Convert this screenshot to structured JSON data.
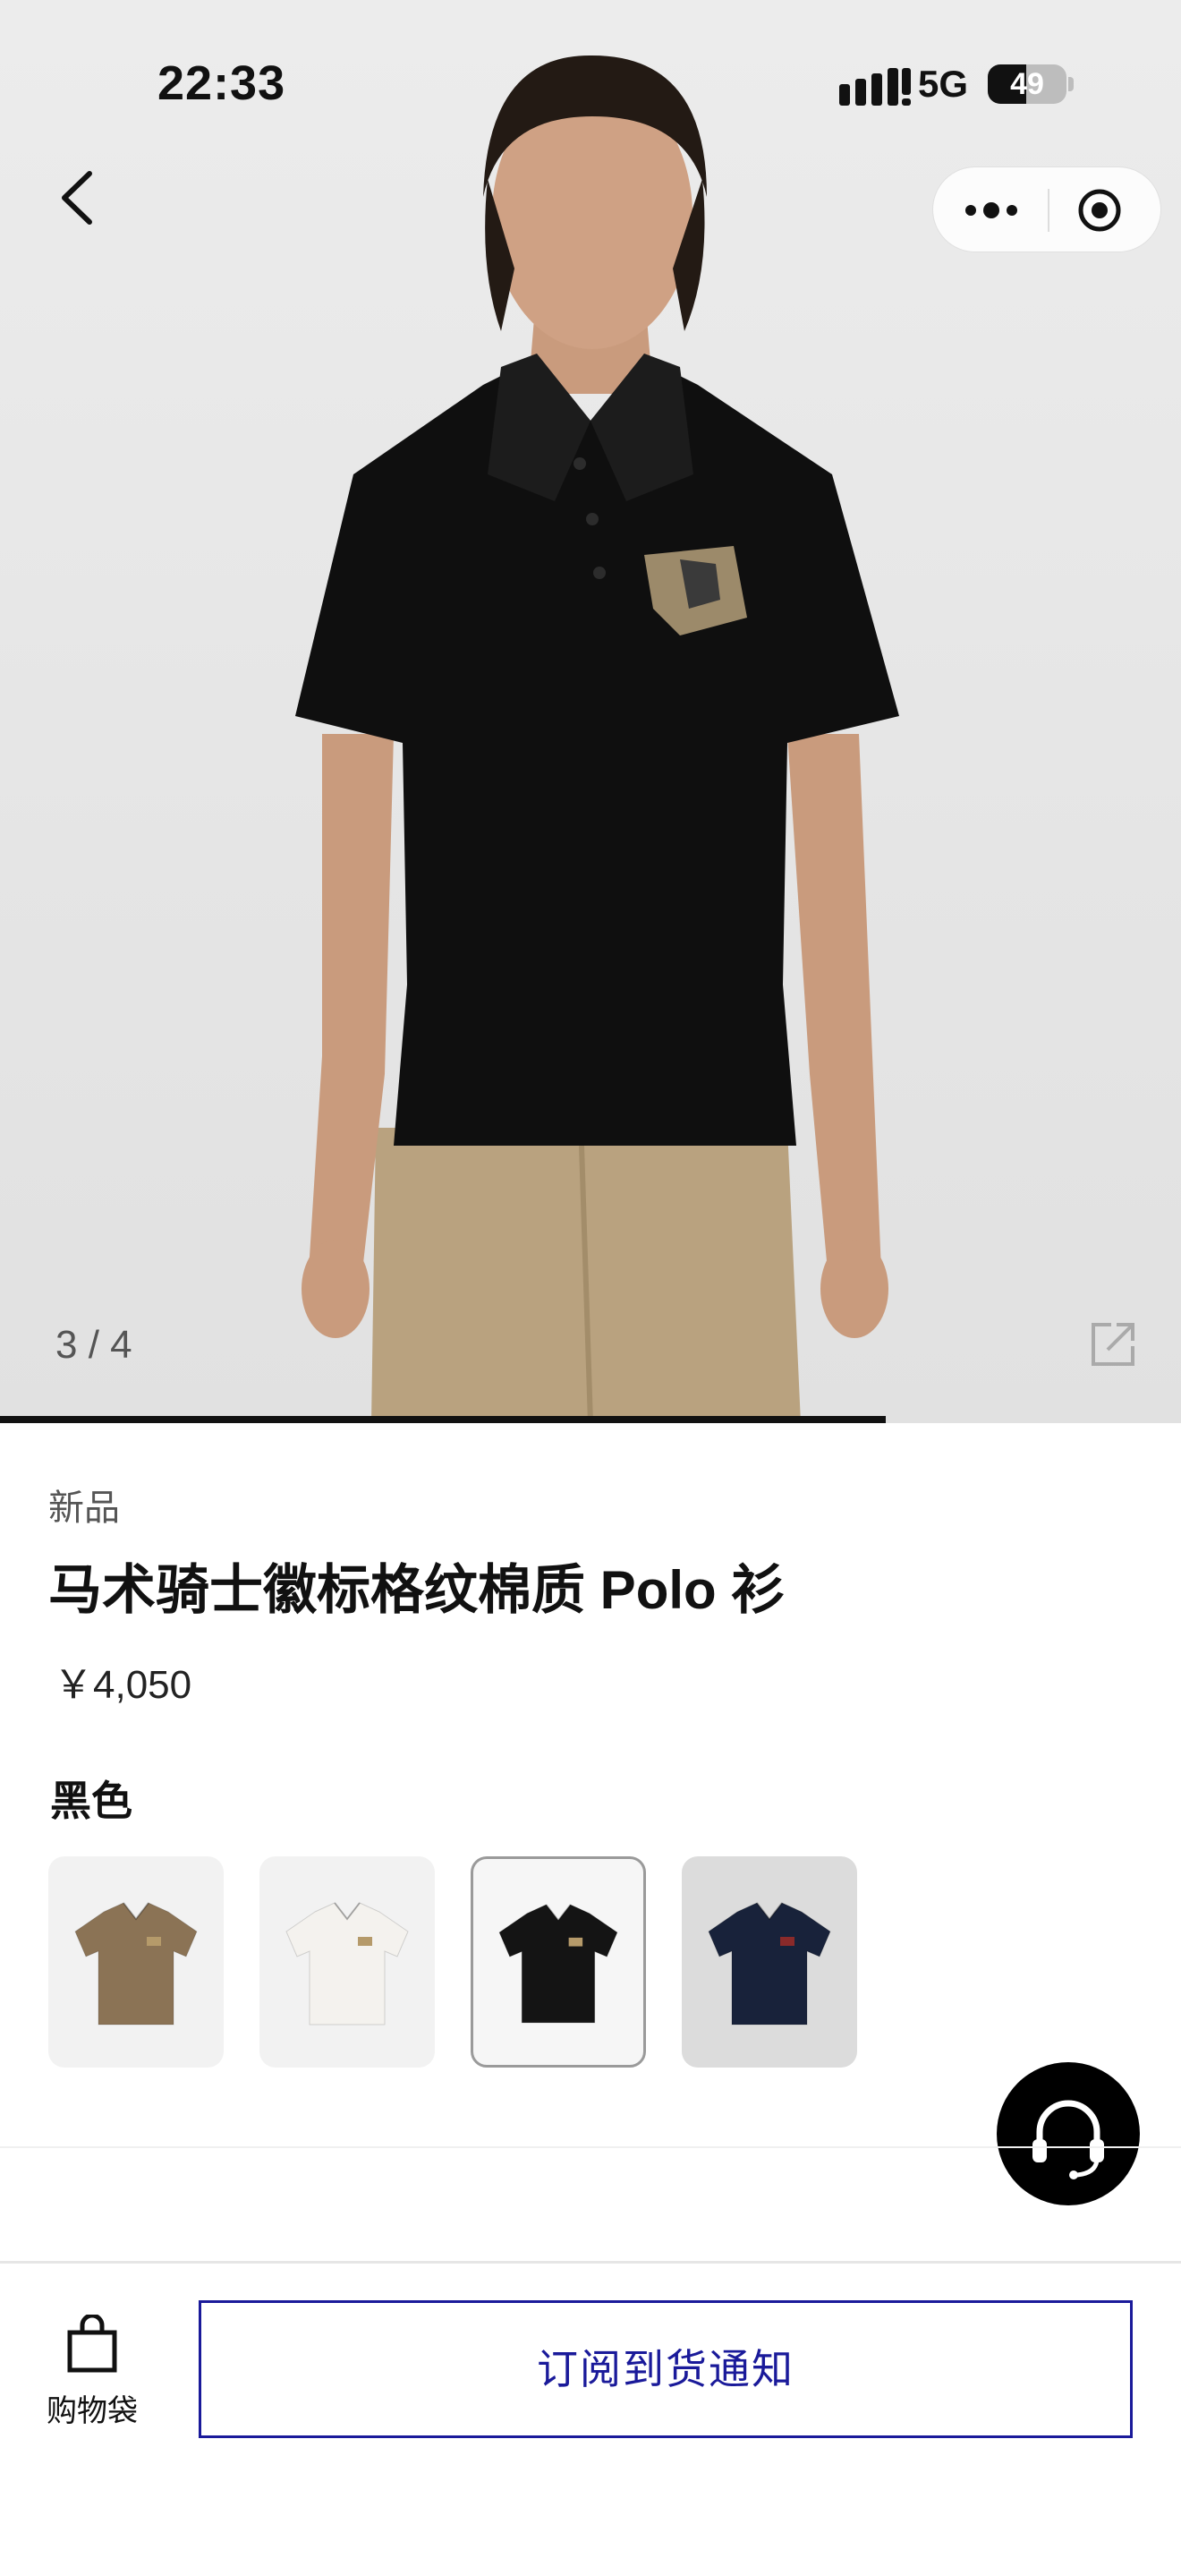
{
  "status_bar": {
    "time": "22:33",
    "network": "5G",
    "battery": "49",
    "battery_level": 0.49
  },
  "gallery": {
    "counter": "3 / 4",
    "current": 3,
    "total": 4,
    "progress": 0.75
  },
  "product": {
    "tag": "新品",
    "title": "马术骑士徽标格纹棉质 Polo 衫",
    "price": "￥4,050",
    "color_label": "黑色",
    "swatches": [
      {
        "name": "brown",
        "shirt_color": "#8b7355",
        "selected": false
      },
      {
        "name": "white",
        "shirt_color": "#f4f2ee",
        "selected": false
      },
      {
        "name": "black",
        "shirt_color": "#141414",
        "selected": true
      },
      {
        "name": "navy",
        "shirt_color": "#18223a",
        "selected": false
      }
    ]
  },
  "bottom_bar": {
    "bag_label": "购物袋",
    "subscribe_label": "订阅到货通知"
  },
  "colors": {
    "accent": "#1a1a9a",
    "text": "#111111"
  }
}
